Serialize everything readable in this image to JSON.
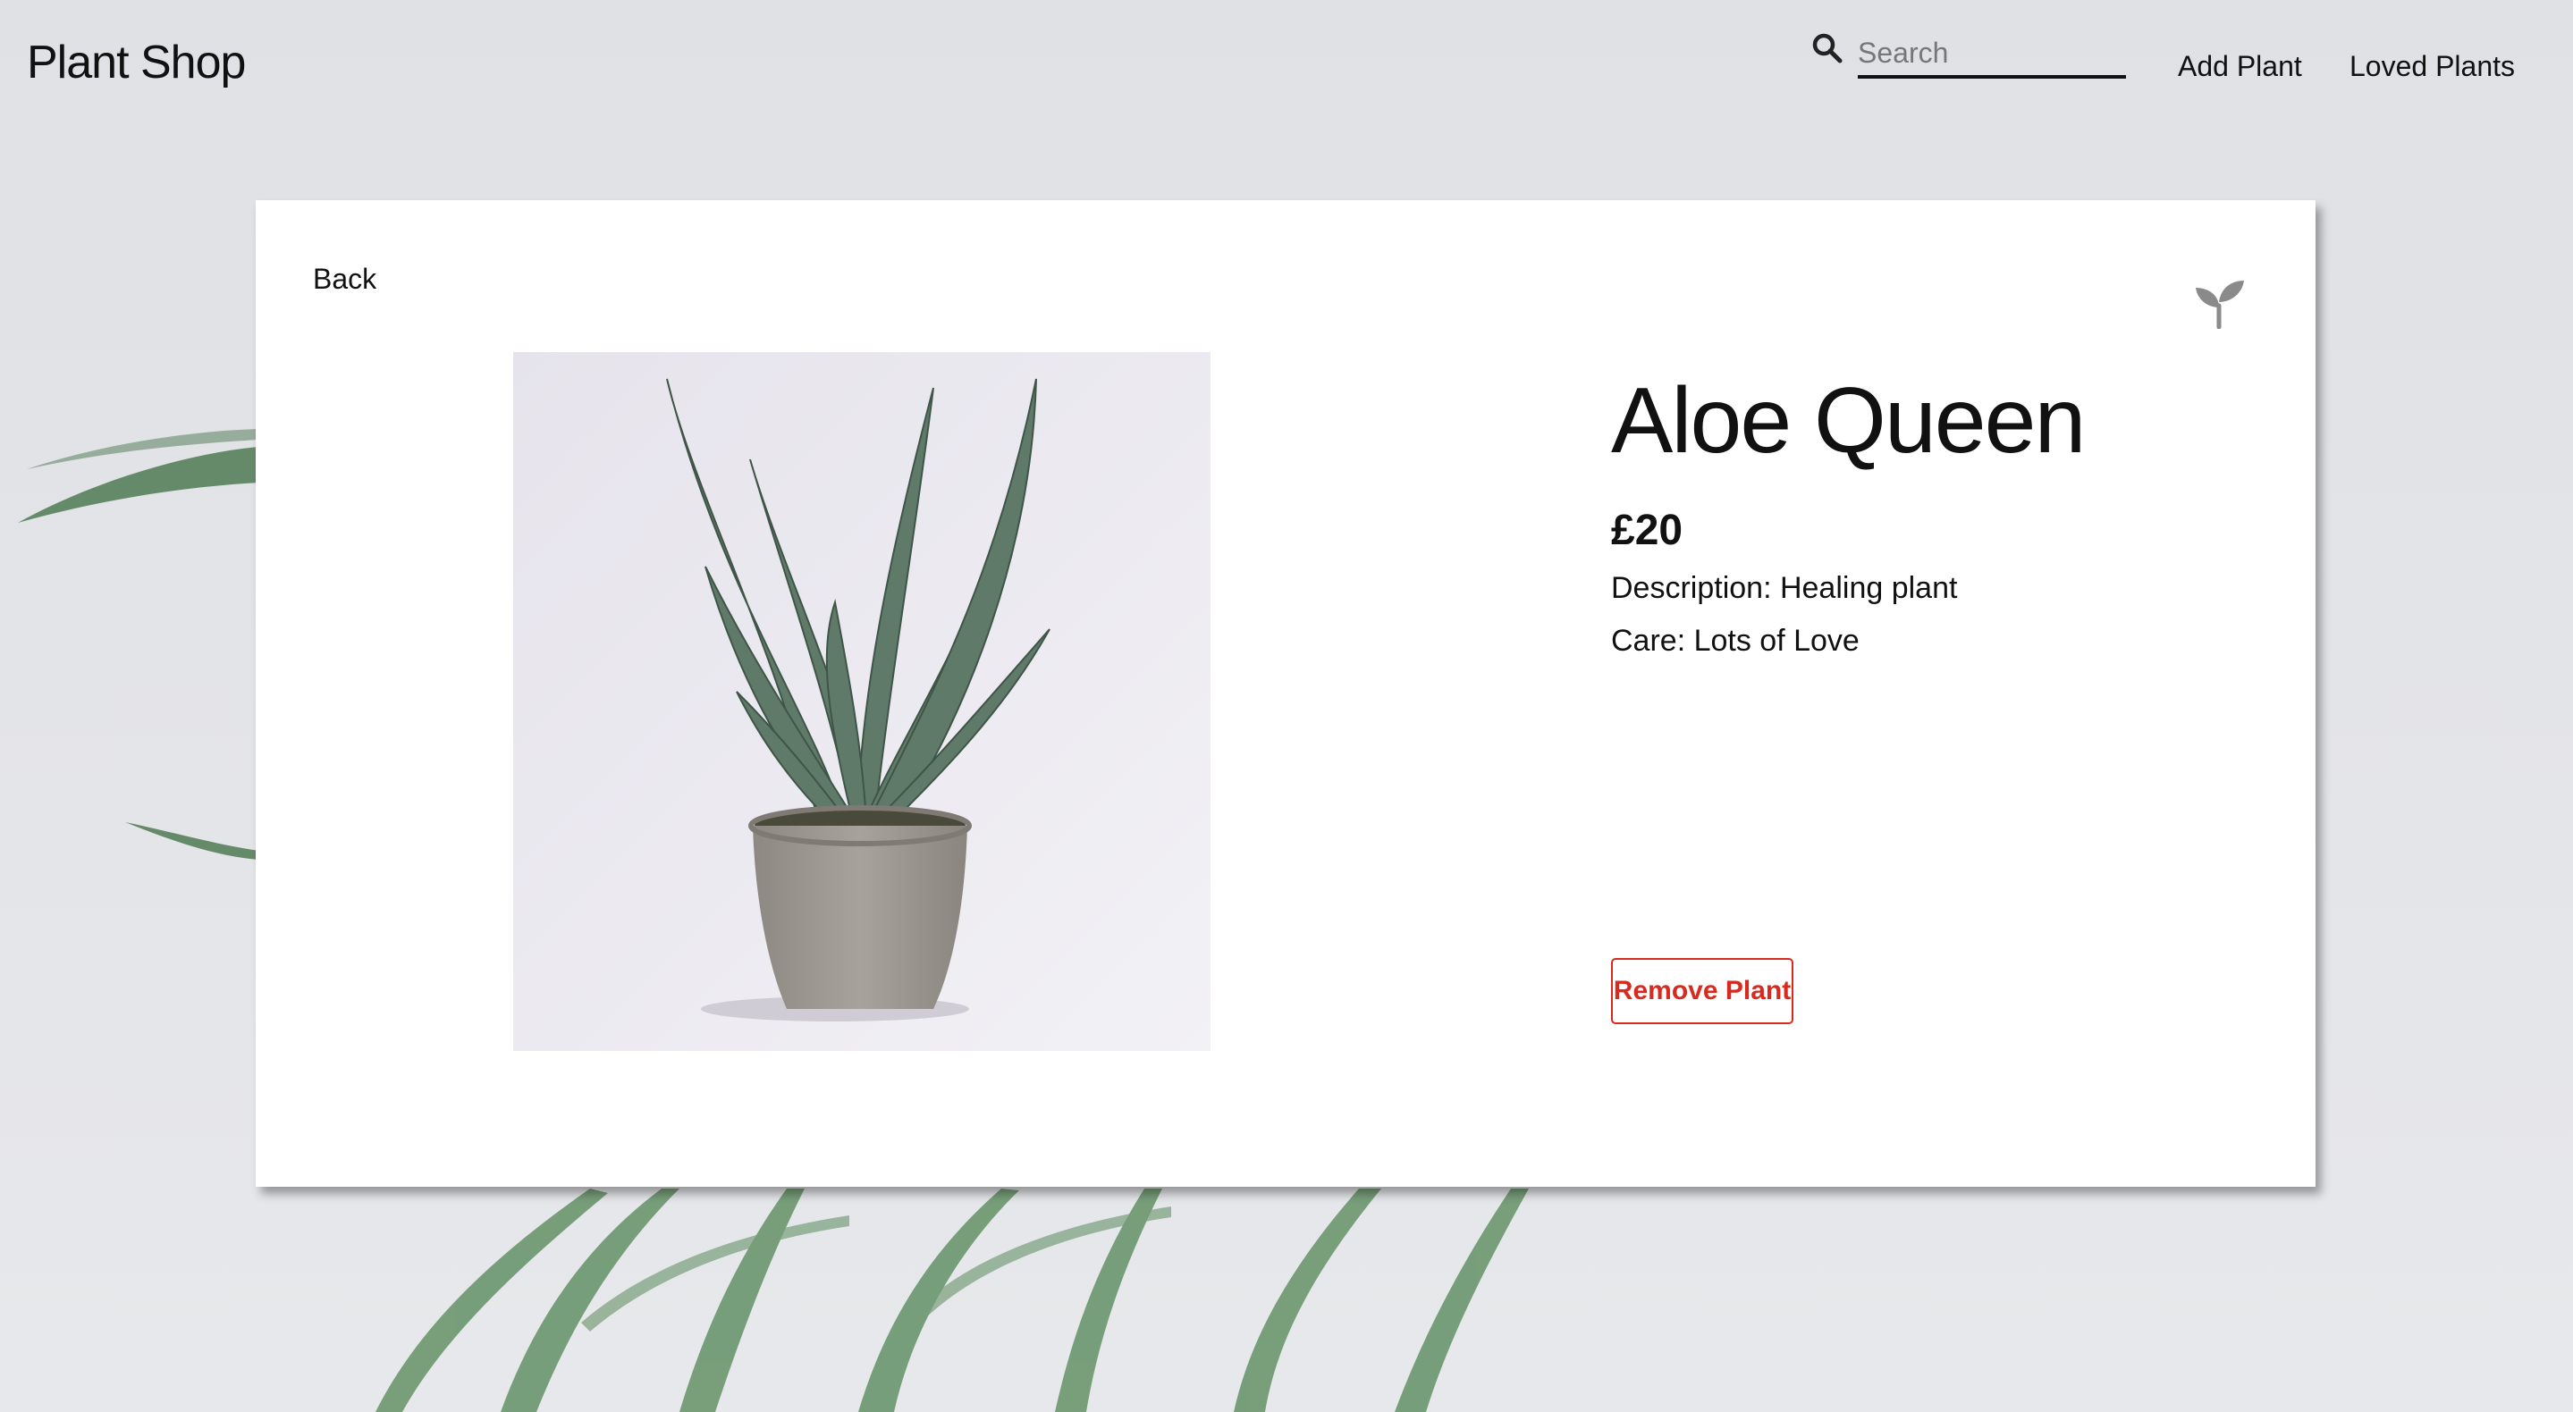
{
  "header": {
    "brand": "Plant Shop",
    "search": {
      "placeholder": "Search",
      "value": ""
    },
    "nav": {
      "add_plant": "Add Plant",
      "loved_plants": "Loved Plants"
    }
  },
  "card": {
    "back_label": "Back",
    "plant": {
      "name": "Aloe Queen",
      "price": "£20",
      "description": "Description: Healing plant",
      "care": "Care: Lots of Love"
    },
    "remove_label": "Remove Plant"
  },
  "icons": {
    "search": "search-icon",
    "love": "sprout-icon"
  },
  "colors": {
    "background": "#e2e3e7",
    "card": "#ffffff",
    "text": "#111111",
    "remove_accent": "#d82a1e",
    "sprout": "#8a8a8a"
  }
}
